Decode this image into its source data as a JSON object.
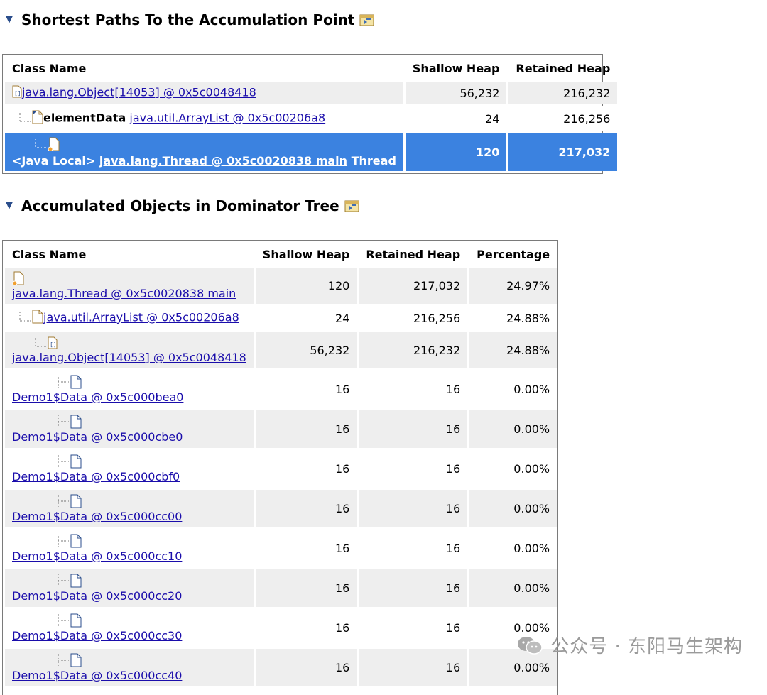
{
  "section1": {
    "title": "Shortest Paths To the Accumulation Point",
    "headers": {
      "class_name": "Class Name",
      "shallow": "Shallow Heap",
      "retained": "Retained Heap"
    },
    "rows": [
      {
        "link": "java.lang.Object[14053] @ 0x5c0048418",
        "shallow": "56,232",
        "retained": "216,232"
      },
      {
        "prefix": "elementData",
        "link": "java.util.ArrayList @ 0x5c00206a8",
        "shallow": "24",
        "retained": "216,256"
      },
      {
        "prefix": "<Java Local>",
        "link": "java.lang.Thread @ 0x5c0020838 main",
        "suffix": "Thread",
        "shallow": "120",
        "retained": "217,032"
      }
    ]
  },
  "section2": {
    "title": "Accumulated Objects in Dominator Tree",
    "headers": {
      "class_name": "Class Name",
      "shallow": "Shallow Heap",
      "retained": "Retained Heap",
      "percentage": "Percentage"
    },
    "rows": [
      {
        "link": "java.lang.Thread @ 0x5c0020838 main",
        "shallow": "120",
        "retained": "217,032",
        "percentage": "24.97%"
      },
      {
        "link": "java.util.ArrayList @ 0x5c00206a8",
        "shallow": "24",
        "retained": "216,256",
        "percentage": "24.88%"
      },
      {
        "link": "java.lang.Object[14053] @ 0x5c0048418",
        "shallow": "56,232",
        "retained": "216,232",
        "percentage": "24.88%"
      },
      {
        "link": "Demo1$Data @ 0x5c000bea0",
        "shallow": "16",
        "retained": "16",
        "percentage": "0.00%"
      },
      {
        "link": "Demo1$Data @ 0x5c000cbe0",
        "shallow": "16",
        "retained": "16",
        "percentage": "0.00%"
      },
      {
        "link": "Demo1$Data @ 0x5c000cbf0",
        "shallow": "16",
        "retained": "16",
        "percentage": "0.00%"
      },
      {
        "link": "Demo1$Data @ 0x5c000cc00",
        "shallow": "16",
        "retained": "16",
        "percentage": "0.00%"
      },
      {
        "link": "Demo1$Data @ 0x5c000cc10",
        "shallow": "16",
        "retained": "16",
        "percentage": "0.00%"
      },
      {
        "link": "Demo1$Data @ 0x5c000cc20",
        "shallow": "16",
        "retained": "16",
        "percentage": "0.00%"
      },
      {
        "link": "Demo1$Data @ 0x5c000cc30",
        "shallow": "16",
        "retained": "16",
        "percentage": "0.00%"
      },
      {
        "link": "Demo1$Data @ 0x5c000cc40",
        "shallow": "16",
        "retained": "16",
        "percentage": "0.00%"
      }
    ]
  },
  "watermark": {
    "text": "公众号 · 东阳马生架构",
    "logo_icon": "wechat-icon"
  },
  "colors": {
    "selection": "#3b82e0",
    "link": "#1a0dab",
    "row_alt": "#eeeeee"
  }
}
